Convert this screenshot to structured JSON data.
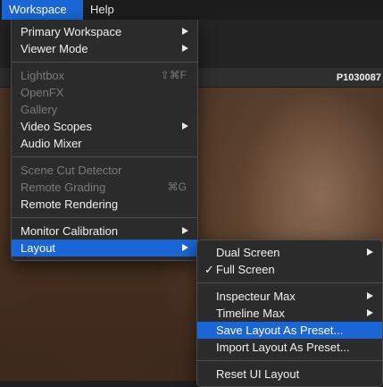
{
  "menubar": {
    "workspace": "Workspace",
    "help": "Help"
  },
  "viewer": {
    "clip_name": "P1030087"
  },
  "workspace_menu": {
    "primary_workspace": "Primary Workspace",
    "viewer_mode": "Viewer Mode",
    "lightbox": "Lightbox",
    "lightbox_shortcut": "⇧⌘F",
    "openfx": "OpenFX",
    "gallery": "Gallery",
    "video_scopes": "Video Scopes",
    "audio_mixer": "Audio Mixer",
    "scene_cut_detector": "Scene Cut Detector",
    "remote_grading": "Remote Grading",
    "remote_grading_shortcut": "⌘G",
    "remote_rendering": "Remote Rendering",
    "monitor_calibration": "Monitor Calibration",
    "layout": "Layout"
  },
  "layout_submenu": {
    "dual_screen": "Dual Screen",
    "full_screen": "Full Screen",
    "full_screen_check": "✓",
    "inspecteur_max": "Inspecteur Max",
    "timeline_max": "Timeline Max",
    "save_layout_as_preset": "Save Layout As Preset...",
    "import_layout_as_preset": "Import Layout As Preset...",
    "reset_ui_layout": "Reset UI Layout"
  },
  "colors": {
    "accent": "#1a66d6",
    "menu_bg": "#2b2b2b",
    "disabled_text": "#7a7a7a"
  }
}
